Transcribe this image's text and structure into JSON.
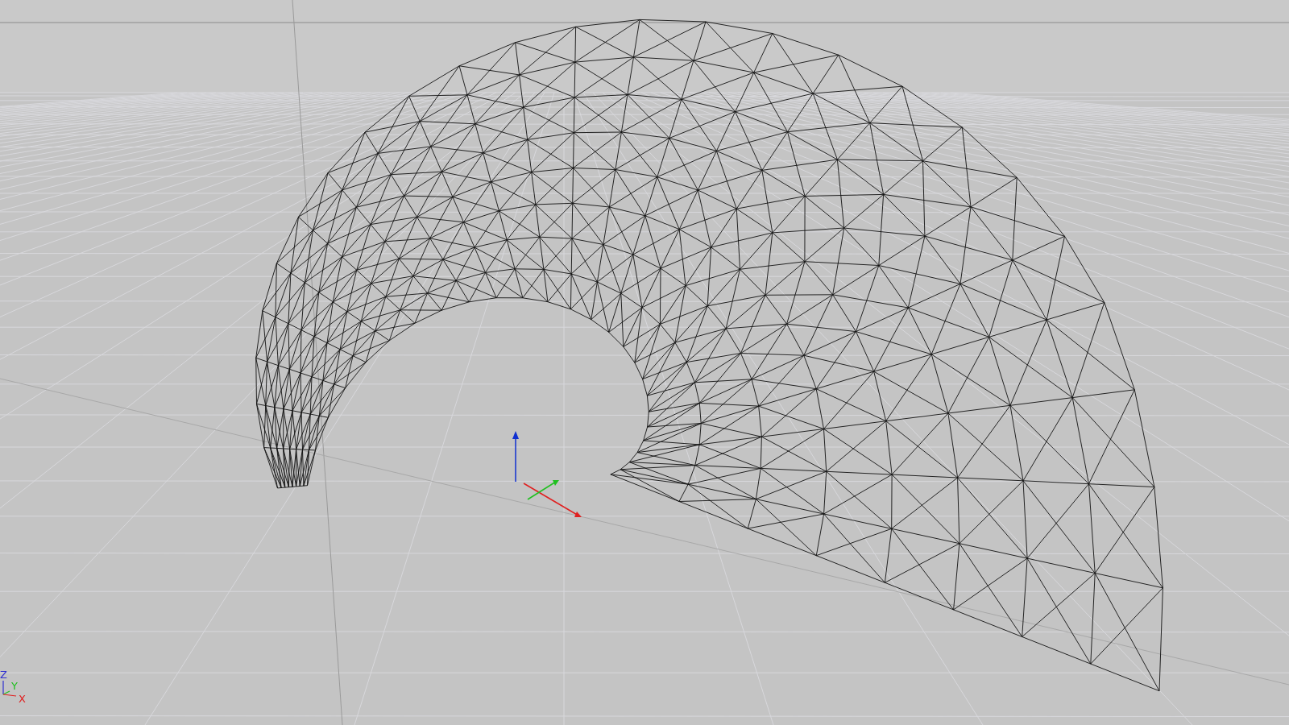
{
  "viewport": {
    "axis_indicator": {
      "z": "Z",
      "y": "Y",
      "x": "X"
    }
  }
}
